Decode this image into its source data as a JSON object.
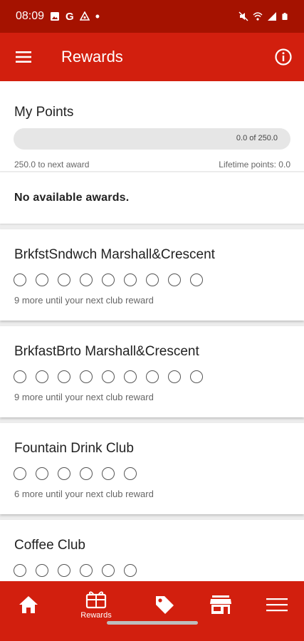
{
  "status_bar": {
    "time": "08:09",
    "extra_icons": [
      "image-icon",
      "google-icon",
      "a-icon",
      "dot-icon"
    ],
    "right_icons": [
      "mute-icon",
      "wifi-icon",
      "signal-icon",
      "battery-icon"
    ],
    "g_letter": "G"
  },
  "app_bar": {
    "title": "Rewards",
    "menu_icon": "menu-icon",
    "info_icon": "info-icon"
  },
  "points": {
    "title": "My Points",
    "progress_text": "0.0 of 250.0",
    "progress_fraction": 0.0,
    "to_next": "250.0 to next award",
    "lifetime": "Lifetime points: 0.0"
  },
  "awards": {
    "text": "No available awards."
  },
  "clubs": [
    {
      "name": "BrkfstSndwch Marshall&Crescent",
      "circles": 9,
      "message": "9 more until your next club reward"
    },
    {
      "name": "BrkfastBrto Marshall&Crescent",
      "circles": 9,
      "message": "9 more until your next club reward"
    },
    {
      "name": "Fountain Drink Club",
      "circles": 6,
      "message": "6 more until your next club reward"
    },
    {
      "name": "Coffee Club",
      "circles": 6,
      "message": ""
    }
  ],
  "bottom_nav": {
    "items": [
      {
        "icon": "home-icon",
        "label": ""
      },
      {
        "icon": "rewards-icon",
        "label": "Rewards"
      },
      {
        "icon": "tag-icon",
        "label": ""
      },
      {
        "icon": "store-icon",
        "label": ""
      },
      {
        "icon": "menu-icon",
        "label": ""
      }
    ]
  },
  "colors": {
    "primary": "#d21f0e",
    "status_bar": "#a51200",
    "background": "#ededed"
  }
}
